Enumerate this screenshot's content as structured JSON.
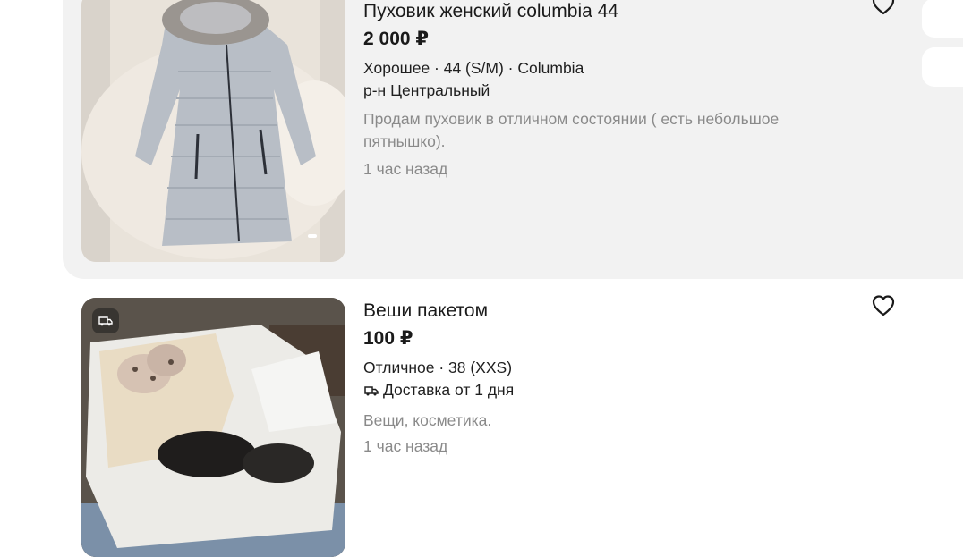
{
  "listings": [
    {
      "title": "Пуховик женский columbia 44",
      "price": "2 000 ₽",
      "params": "Хорошее · 44 (S/M) · Columbia",
      "location": "р-н Центральный",
      "description": "Продам пуховик в отличном состоянии ( есть небольшое пятнышко).",
      "time": "1 час назад",
      "image": "grey-puffer-coat-photo"
    },
    {
      "title": "Веши пакетом",
      "price": "100 ₽",
      "params": "Отличное · 38 (XXS)",
      "delivery": "Доставка от 1 дня",
      "description": "Вещи, косметика.",
      "time": "1 час назад",
      "image": "clothes-in-bag-photo",
      "badge_icon": "delivery-truck-icon"
    }
  ],
  "colors": {
    "card_background": "#f2f2f2",
    "muted_text": "#8a8a8a",
    "primary_text": "#1a1a1a"
  }
}
